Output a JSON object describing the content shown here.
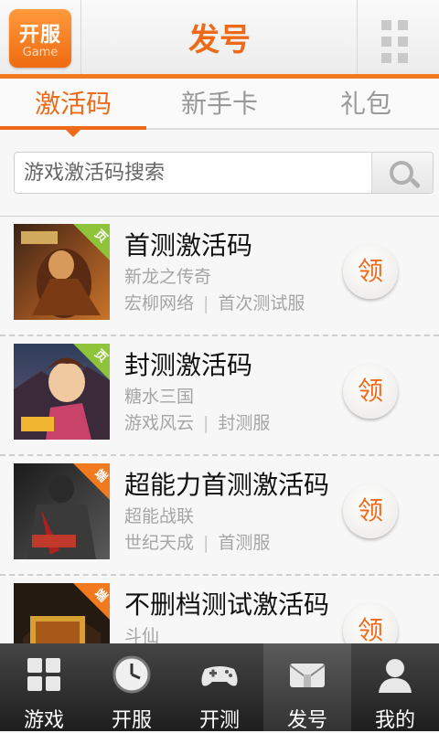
{
  "header": {
    "logo_main": "开服",
    "logo_sub": "Game",
    "title": "发号",
    "menu_icon": "grid-menu-icon"
  },
  "tabs": [
    {
      "label": "激活码",
      "active": true
    },
    {
      "label": "新手卡",
      "active": false
    },
    {
      "label": "礼包",
      "active": false
    }
  ],
  "search": {
    "placeholder": "游戏激活码搜索",
    "icon": "search-icon"
  },
  "items": [
    {
      "title": "首测激活码",
      "game": "新龙之传奇",
      "publisher": "宏柳网络",
      "server": "首次测试服",
      "badge": "页",
      "badge_color": "#8fc33a",
      "claim_label": "领"
    },
    {
      "title": "封测激活码",
      "game": "糖水三国",
      "publisher": "游戏风云",
      "server": "封测服",
      "badge": "页",
      "badge_color": "#8fc33a",
      "claim_label": "领"
    },
    {
      "title": "超能力首测激活码",
      "game": "超能战联",
      "publisher": "世纪天成",
      "server": "首测服",
      "badge": "端",
      "badge_color": "#f07a1d",
      "claim_label": "领"
    },
    {
      "title": "不删档测试激活码",
      "game": "斗仙",
      "publisher": "",
      "server": "",
      "badge": "端",
      "badge_color": "#f07a1d",
      "claim_label": "领"
    }
  ],
  "nav": [
    {
      "label": "游戏",
      "icon": "games-grid-icon",
      "active": false
    },
    {
      "label": "开服",
      "icon": "clock-icon",
      "active": false
    },
    {
      "label": "开测",
      "icon": "gamepad-icon",
      "active": false
    },
    {
      "label": "发号",
      "icon": "gift-envelope-icon",
      "active": true
    },
    {
      "label": "我的",
      "icon": "user-icon",
      "active": false
    }
  ],
  "colors": {
    "accent": "#ef6a18",
    "nav_bg": "#2a2a2a"
  }
}
